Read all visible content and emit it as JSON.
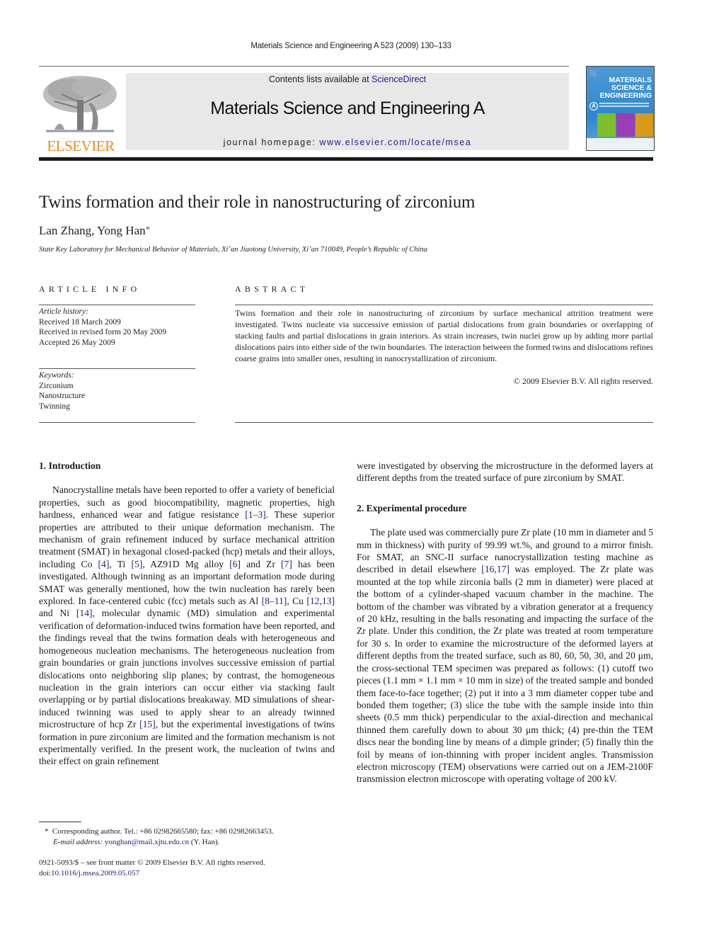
{
  "running_head": "Materials Science and Engineering A 523 (2009) 130–133",
  "banner": {
    "contents_prefix": "Contents lists available at ",
    "contents_link": "ScienceDirect",
    "journal_name": "Materials Science and Engineering A",
    "homepage_prefix": "journal homepage: ",
    "homepage_link": "www.elsevier.com/locate/msea"
  },
  "publisher_logo": {
    "wordmark": "ELSEVIER",
    "icon": "elsevier-tree-icon",
    "color": "#f08a24"
  },
  "cover": {
    "title_lines": [
      "MATERIALS",
      "SCIENCE &",
      "ENGINEERING"
    ],
    "series_letter": "A"
  },
  "article": {
    "title": "Twins formation and their role in nanostructuring of zirconium",
    "authors": "Lan Zhang, Yong Han",
    "corresponding_mark": "*",
    "affiliation": "State Key Laboratory for Mechanical Behavior of Materials, Xi’an Jiaotong University, Xi’an 710049, People’s Republic of China"
  },
  "article_info": {
    "heading": "ARTICLE INFO",
    "history_label": "Article history:",
    "history": [
      "Received 18 March 2009",
      "Received in revised form 20 May 2009",
      "Accepted 26 May 2009"
    ],
    "keywords_label": "Keywords:",
    "keywords": [
      "Zirconium",
      "Nanostructure",
      "Twinning"
    ]
  },
  "abstract": {
    "heading": "ABSTRACT",
    "text": "Twins formation and their role in nanostructuring of zirconium by surface mechanical attrition treatment were investigated. Twins nucleate via successive emission of partial dislocations from grain boundaries or overlapping of stacking faults and partial dislocations in grain interiors. As strain increases, twin nuclei grow up by adding more partial dislocations pairs into either side of the twin boundaries. The interaction between the formed twins and dislocations refines coarse grains into smaller ones, resulting in nanocrystallization of zirconium.",
    "copyright": "© 2009 Elsevier B.V. All rights reserved."
  },
  "sections": {
    "intro_heading": "1.  Introduction",
    "intro": {
      "t1": "Nanocrystalline metals have been reported to offer a variety of beneficial properties, such as good biocompatibility, magnetic properties, high hardness, enhanced wear and fatigue resistance ",
      "r1": "[1–3]",
      "t2": ". These superior properties are attributed to their unique deformation mechanism. The mechanism of grain refinement induced by surface mechanical attrition treatment (SMAT) in hexagonal closed-packed (hcp) metals and their alloys, including Co ",
      "r2": "[4]",
      "t3": ", Ti ",
      "r3": "[5]",
      "t4": ", AZ91D Mg alloy ",
      "r4": "[6]",
      "t5": " and Zr ",
      "r5": "[7]",
      "t6": " has been investigated. Although twinning as an important deformation mode during SMAT was generally mentioned, how the twin nucleation has rarely been explored. In face-centered cubic (fcc) metals such as Al ",
      "r6": "[8–11]",
      "t7": ", Cu ",
      "r7": "[12,13]",
      "t8": " and Ni ",
      "r8": "[14]",
      "t9": ", molecular dynamic (MD) simulation and experimental verification of deformation-induced twins formation have been reported, and the findings reveal that the twins formation deals with heterogeneous and homogeneous nucleation mechanisms. The heterogeneous nucleation from grain boundaries or grain junctions involves successive emission of partial dislocations onto neighboring slip planes; by contrast, the homogeneous nucleation in the grain interiors can occur either via stacking fault overlapping or by partial dislocations breakaway. MD simulations of shear-induced twinning was used to apply shear to an already twinned microstructure of hcp Zr ",
      "r9": "[15]",
      "t10": ", but the experimental investigations of twins formation in pure zirconium are limited and the formation mechanism is not experimentally verified. In the present work, the nucleation of twins and their effect on grain refinement",
      "continued": "were investigated by observing the microstructure in the deformed layers at different depths from the treated surface of pure zirconium by SMAT."
    },
    "exp_heading": "2.  Experimental procedure",
    "exp": {
      "t1": "The plate used was commercially pure Zr plate (10 mm in diameter and 5 mm in thickness) with purity of 99.99 wt.%, and ground to a mirror finish. For SMAT, an SNC-II surface nanocrystallization testing machine as described in detail elsewhere ",
      "r1": "[16,17]",
      "t2": " was employed. The Zr plate was mounted at the top while zirconia balls (2 mm in diameter) were placed at the bottom of a cylinder-shaped vacuum chamber in the machine. The bottom of the chamber was vibrated by a vibration generator at a frequency of 20 kHz, resulting in the balls resonating and impacting the surface of the Zr plate. Under this condition, the Zr plate was treated at room temperature for 30 s. In order to examine the microstructure of the deformed layers at different depths from the treated surface, such as 80, 60, 50, 30, and 20 μm, the cross-sectional TEM specimen was prepared as follows: (1) cutoff two pieces (1.1 mm × 1.1 mm × 10 mm in size) of the treated sample and bonded them face-to-face together; (2) put it into a 3 mm diameter copper tube and bonded them together; (3) slice the tube with the sample inside into thin sheets (0.5 mm thick) perpendicular to the axial-direction and mechanical thinned them carefully down to about 30 μm thick; (4) pre-thin the TEM discs near the bonding line by means of a dimple grinder; (5) finally thin the foil by means of ion-thinning with proper incident angles. Transmission electron microscopy (TEM) observations were carried out on a JEM-2100F transmission electron microscope with operating voltage of 200 kV."
    }
  },
  "footnote": {
    "mark": "*",
    "corresponding": "Corresponding author. Tel.: +86 02982665580; fax: +86 02982663453.",
    "email_label": "E-mail address:",
    "email": "yonghan@mail.xjtu.edu.cn",
    "email_suffix": " (Y. Han)."
  },
  "front_matter": {
    "issn_line": "0921-5093/$ – see front matter © 2009 Elsevier B.V. All rights reserved.",
    "doi_prefix": "doi:",
    "doi": "10.1016/j.msea.2009.05.057"
  }
}
